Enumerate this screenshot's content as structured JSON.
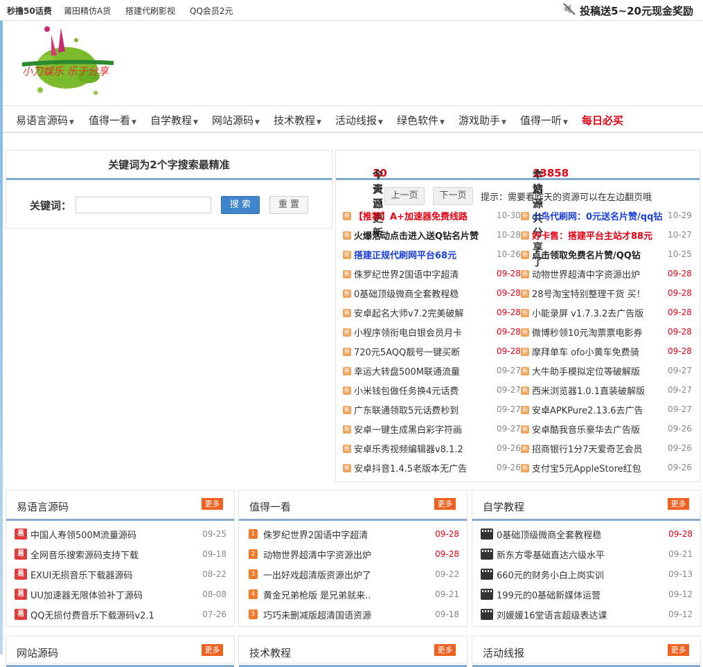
{
  "topbar": {
    "links": [
      "秒撸50话费",
      "莆田精仿A货",
      "搭建代刷影视",
      "QQ会员2元"
    ],
    "promo": "投稿送5~20元现金奖励"
  },
  "logo": {
    "text": "小刀娱乐 乐于分享"
  },
  "nav": {
    "items": [
      "易语言源码",
      "值得一看",
      "自学教程",
      "网站源码",
      "技术教程",
      "活动线报",
      "绿色软件",
      "游戏助手",
      "值得一听"
    ],
    "hot": "每日必买"
  },
  "search": {
    "title": "关键词为2个字搜索最精准",
    "label": "关键词：",
    "input_value": "",
    "search_button": "搜 索",
    "reset_button": "重 置"
  },
  "latest": {
    "today_prefix": "今天已更新",
    "today_count": "10",
    "today_suffix": "个资源",
    "total_prefix": "本站一共分享了",
    "total_count": "13858",
    "total_suffix": "个资源",
    "prev": "上一页",
    "next": "下一页",
    "tip": "提示：需要看昨天的资源可以在左边翻页哦",
    "icon_text": "新",
    "left": [
      {
        "title": "【推荐】A+加速器免费线路",
        "date": "10-30",
        "style": "redb"
      },
      {
        "title": "火爆活动点击进入送Q钻名片赞",
        "date": "10-28",
        "style": "b"
      },
      {
        "title": "搭建正规代刷网平台68元",
        "date": "10-26",
        "style": "blue"
      },
      {
        "title": "侏罗纪世界2国语中字超清",
        "date": "09-28",
        "style": "n",
        "hot": true
      },
      {
        "title": "0基础顶级微商全套教程稳",
        "date": "09-28",
        "style": "n",
        "hot": true
      },
      {
        "title": "安卓起名大师v7.2完美破解",
        "date": "09-28",
        "style": "n",
        "hot": true
      },
      {
        "title": "小程序领衔电白银会员月卡",
        "date": "09-28",
        "style": "n",
        "hot": true
      },
      {
        "title": "720元5AQQ靓号一键买断",
        "date": "09-28",
        "style": "n",
        "hot": true
      },
      {
        "title": "幸运大转盘500M联通流量",
        "date": "09-27",
        "style": "n"
      },
      {
        "title": "小米钱包做任务换4元话费",
        "date": "09-27",
        "style": "n"
      },
      {
        "title": "广东联通领取5元话费秒到",
        "date": "09-27",
        "style": "n"
      },
      {
        "title": "安卓一键生成黑白彩字符画",
        "date": "09-27",
        "style": "n"
      },
      {
        "title": "安卓乐秀视频编辑器v8.1.2",
        "date": "09-26",
        "style": "n"
      },
      {
        "title": "安卓抖音1.4.5老版本无广告",
        "date": "09-26",
        "style": "n"
      }
    ],
    "right": [
      {
        "title": "小鸟代刷网：0元送名片赞/qq钻",
        "date": "10-29",
        "style": "blue"
      },
      {
        "title": "好卡售：搭建平台主站才88元",
        "date": "10-27",
        "style": "redb"
      },
      {
        "title": "点击领取免费名片赞/QQ钻",
        "date": "10-25",
        "style": "b"
      },
      {
        "title": "动物世界超清中字资源出炉",
        "date": "09-28",
        "style": "n",
        "hot": true
      },
      {
        "title": "28号淘宝特别整理干货 买！",
        "date": "09-28",
        "style": "n",
        "hot": true
      },
      {
        "title": "小能录屏 v1.7.3.2去广告版",
        "date": "09-28",
        "style": "n",
        "hot": true
      },
      {
        "title": "微博秒领10元淘票票电影券",
        "date": "09-28",
        "style": "n",
        "hot": true
      },
      {
        "title": "摩拜单车 ofo小黄车免费骑",
        "date": "09-28",
        "style": "n",
        "hot": true
      },
      {
        "title": "大牛助手模拟定位等破解版",
        "date": "09-27",
        "style": "n"
      },
      {
        "title": "西米浏览器1.0.1直装破解版",
        "date": "09-27",
        "style": "n"
      },
      {
        "title": "安卓APKPure2.13.6去广告",
        "date": "09-27",
        "style": "n"
      },
      {
        "title": "安卓酷我音乐豪华去广告版",
        "date": "09-26",
        "style": "n"
      },
      {
        "title": "招商银行1分7天爱奇艺会员",
        "date": "09-26",
        "style": "n"
      },
      {
        "title": "支付宝5元AppleStore红包",
        "date": "09-26",
        "style": "n"
      }
    ]
  },
  "categories": [
    {
      "name": "易语言源码",
      "more": "更多",
      "icon": "yi",
      "icon_text": "易",
      "items": [
        {
          "title": "中国人寿领500M流量源码",
          "date": "09-25",
          "hot": false
        },
        {
          "title": "全网音乐搜索源码支持下载",
          "date": "09-18",
          "hot": false
        },
        {
          "title": "EXUI无损音乐下载器源码",
          "date": "08-22",
          "hot": false
        },
        {
          "title": "UU加速器无限体验补丁源码",
          "date": "08-08",
          "hot": false
        },
        {
          "title": "QQ无损付费音乐下载源码v2.1",
          "date": "07-26",
          "hot": false
        }
      ]
    },
    {
      "name": "值得一看",
      "more": "更多",
      "icon": "num",
      "items": [
        {
          "title": "侏罗纪世界2国语中字超清",
          "date": "09-28",
          "hot": true,
          "num": "1"
        },
        {
          "title": "动物世界超清中字资源出炉",
          "date": "09-28",
          "hot": true,
          "num": "2"
        },
        {
          "title": "一出好戏超清版资源出炉了",
          "date": "09-22",
          "hot": false,
          "num": "3"
        },
        {
          "title": "黄金兄弟枪版 是兄弟就来..",
          "date": "09-21",
          "hot": false,
          "num": "4"
        },
        {
          "title": "巧巧未删减版超清国语资源",
          "date": "09-18",
          "hot": false,
          "num": "5"
        }
      ]
    },
    {
      "name": "自学教程",
      "more": "更多",
      "icon": "film",
      "items": [
        {
          "title": "0基础顶级微商全套教程稳",
          "date": "09-28",
          "hot": true
        },
        {
          "title": "新东方零基础直达六级水平",
          "date": "09-21",
          "hot": false
        },
        {
          "title": "660元的财务小白上岗实训",
          "date": "09-13",
          "hot": false
        },
        {
          "title": "199元的0基础新媒体运营",
          "date": "09-12",
          "hot": false
        },
        {
          "title": "刘媛媛16堂语言超级表达课",
          "date": "09-12",
          "hot": false
        }
      ]
    }
  ],
  "categories_row2": [
    {
      "name": "网站源码",
      "more": "更多"
    },
    {
      "name": "技术教程",
      "more": "更多"
    },
    {
      "name": "活动线报",
      "more": "更多"
    }
  ],
  "colors": {
    "accent_blue": "#82a9cf",
    "hot_red": "#e60012",
    "more_orange": "#f0611f",
    "button_blue": "#3e85cc"
  }
}
